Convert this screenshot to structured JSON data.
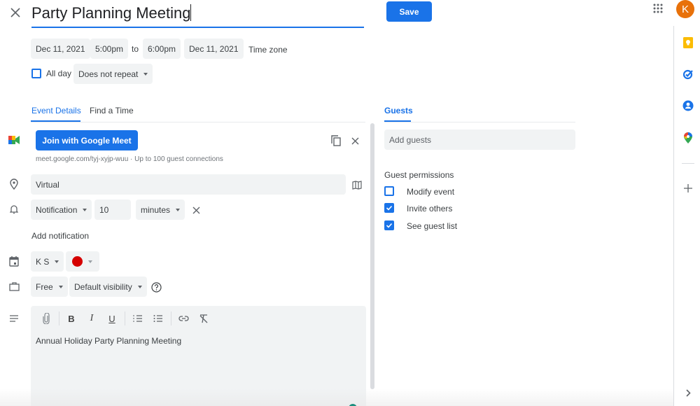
{
  "header": {
    "title_value": "Party Planning Meeting",
    "save_label": "Save",
    "avatar_initial": "K",
    "avatar_color": "#e8710a",
    "accent_color": "#1a73e8"
  },
  "datetime": {
    "start_date": "Dec 11, 2021",
    "start_time": "5:00pm",
    "to_label": "to",
    "end_time": "6:00pm",
    "end_date": "Dec 11, 2021",
    "timezone_label": "Time zone",
    "all_day_label": "All day",
    "all_day_checked": false,
    "repeat_value": "Does not repeat"
  },
  "tabs": {
    "event_details": "Event Details",
    "find_time": "Find a Time",
    "guests": "Guests",
    "active": "Event Details"
  },
  "meet": {
    "join_label": "Join with Google Meet",
    "link_info": "meet.google.com/tyj-xyjp-wuu · Up to 100 guest connections"
  },
  "location": {
    "value": "Virtual"
  },
  "notification": {
    "type": "Notification",
    "amount": "10",
    "unit": "minutes",
    "add_label": "Add notification"
  },
  "calendar": {
    "owner": "K S",
    "color": "#d50000"
  },
  "availability": {
    "status": "Free",
    "visibility": "Default visibility"
  },
  "description": {
    "text": "Annual Holiday Party Planning Meeting",
    "toolbar": [
      "attachment",
      "bold",
      "italic",
      "underline",
      "numbered-list",
      "bulleted-list",
      "link",
      "clear-formatting"
    ]
  },
  "guests": {
    "placeholder": "Add guests",
    "permissions_title": "Guest permissions",
    "permissions": [
      {
        "label": "Modify event",
        "checked": false
      },
      {
        "label": "Invite others",
        "checked": true
      },
      {
        "label": "See guest list",
        "checked": true
      }
    ]
  },
  "side_panel": {
    "apps": [
      "keep-icon",
      "tasks-icon",
      "contacts-icon",
      "maps-icon"
    ],
    "add_label": "+"
  }
}
